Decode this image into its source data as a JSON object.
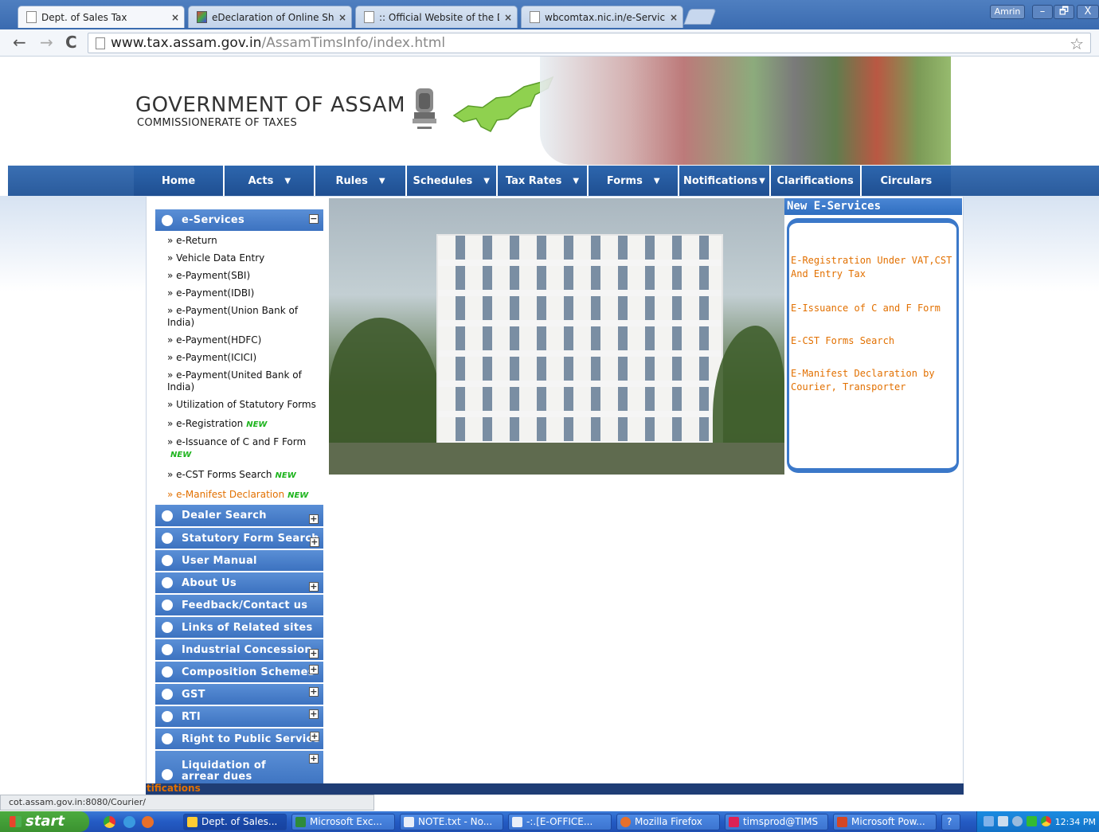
{
  "browser": {
    "tabs": [
      {
        "title": "Dept. of Sales Tax",
        "active": true
      },
      {
        "title": "eDeclaration of Online Shopp",
        "active": false
      },
      {
        "title": ":: Official Website of the Dire",
        "active": false
      },
      {
        "title": "wbcomtax.nic.in/e-Services/",
        "active": false
      }
    ],
    "profile_name": "Amrin",
    "window_buttons": {
      "minimize": "–",
      "restore": "🗗",
      "close": "X"
    },
    "address": {
      "host": "www.tax.assam.gov.in",
      "path": "/AssamTimsInfo/index.html"
    },
    "status_url": "cot.assam.gov.in:8080/Courier/"
  },
  "header": {
    "title": "GOVERNMENT OF ASSAM",
    "subtitle": "COMMISSIONERATE OF TAXES"
  },
  "nav": {
    "items": [
      {
        "label": "Home",
        "dropdown": false
      },
      {
        "label": "Acts",
        "dropdown": true
      },
      {
        "label": "Rules",
        "dropdown": true
      },
      {
        "label": "Schedules",
        "dropdown": true
      },
      {
        "label": "Tax Rates",
        "dropdown": true
      },
      {
        "label": "Forms",
        "dropdown": true
      },
      {
        "label": "Notifications",
        "dropdown": true
      },
      {
        "label": "Clarifications",
        "dropdown": false
      },
      {
        "label": "Circulars",
        "dropdown": false
      }
    ],
    "caret": "▼"
  },
  "sidebar": {
    "eservices": {
      "label": "e-Services",
      "toggle": "−",
      "items": [
        {
          "label": "» e-Return",
          "new": false
        },
        {
          "label": "» Vehicle Data Entry",
          "new": false
        },
        {
          "label": "» e-Payment(SBI)",
          "new": false
        },
        {
          "label": "» e-Payment(IDBI)",
          "new": false
        },
        {
          "label": "» e-Payment(Union Bank of India)",
          "new": false
        },
        {
          "label": "» e-Payment(HDFC)",
          "new": false
        },
        {
          "label": "» e-Payment(ICICI)",
          "new": false
        },
        {
          "label": "» e-Payment(United Bank of India)",
          "new": false
        },
        {
          "label": "» Utilization of Statutory Forms",
          "new": false
        },
        {
          "label": "» e-Registration",
          "new": true
        },
        {
          "label": "» e-Issuance of C and F Form",
          "new": true
        },
        {
          "label": "» e-CST Forms Search",
          "new": true
        },
        {
          "label": "» e-Manifest Declaration",
          "new": true,
          "highlight": true
        }
      ],
      "new_badge": "NEW"
    },
    "sections": [
      {
        "label": "Dealer Search",
        "toggle": "+"
      },
      {
        "label": "Statutory Form Search",
        "toggle": "+"
      },
      {
        "label": "User Manual",
        "toggle": ""
      },
      {
        "label": "About Us",
        "toggle": "+"
      },
      {
        "label": "Feedback/Contact us",
        "toggle": ""
      },
      {
        "label": "Links of Related sites",
        "toggle": ""
      },
      {
        "label": "Industrial Concession",
        "toggle": "+"
      },
      {
        "label": "Composition Schemes",
        "toggle": "+"
      },
      {
        "label": "GST",
        "toggle": "+"
      },
      {
        "label": "RTI",
        "toggle": "+"
      },
      {
        "label": "Right to Public Service",
        "toggle": "+"
      },
      {
        "label": "Liquidation of arrear dues",
        "toggle": "+"
      }
    ]
  },
  "right_panel": {
    "title": "New E-Services",
    "items": [
      "E-Registration Under VAT,CST And Entry Tax",
      "E-Issuance of C and F Form",
      "E-CST Forms Search",
      "E-Manifest Declaration by Courier, Transporter"
    ]
  },
  "footer": {
    "ticker_text": "tifications"
  },
  "taskbar": {
    "start_label": "start",
    "tasks": [
      "Dept. of Sales...",
      "Microsoft Exc...",
      "NOTE.txt - No...",
      "-:.[E-OFFICE...",
      "Mozilla Firefox",
      "timsprod@TIMS",
      "Microsoft Pow...",
      "?"
    ],
    "clock": "12:34 PM"
  },
  "colors": {
    "accent_blue": "#2d66ae",
    "link_orange": "#e27000",
    "new_green": "#1db41d"
  },
  "icons": [
    "page-icon",
    "back-arrow-icon",
    "forward-arrow-icon",
    "reload-icon",
    "star-icon",
    "national-emblem-icon",
    "assam-map-icon",
    "windows-flag-icon"
  ]
}
